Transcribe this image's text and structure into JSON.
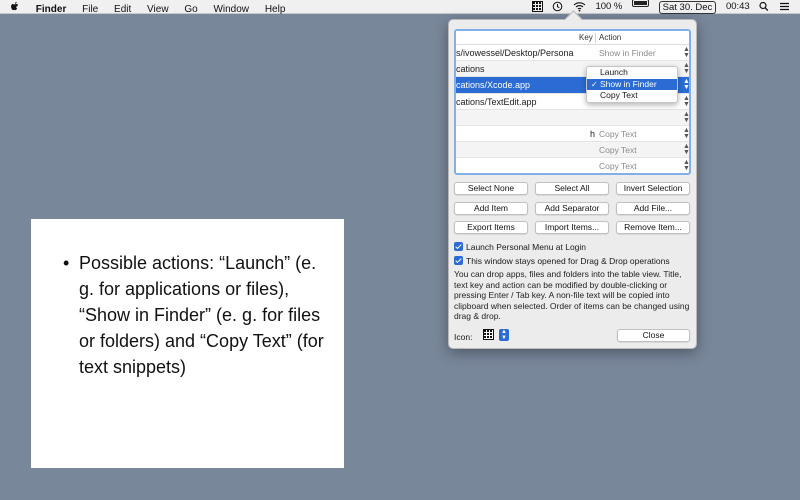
{
  "menubar": {
    "app_name": "Finder",
    "menus": [
      "File",
      "Edit",
      "View",
      "Go",
      "Window",
      "Help"
    ],
    "battery": "100 %",
    "date": "Sat 30. Dec",
    "time": "00:43",
    "icons": [
      "apple-icon",
      "personal-menu-grid-icon",
      "time-machine-icon",
      "wifi-icon",
      "battery-icon",
      "search-icon",
      "control-center-icon"
    ]
  },
  "slide": {
    "bullet": "Possible actions: “Launch” (e. g. for applications or files), “Show in Finder” (e. g. for files or folders) and “Copy Text” (for text snippets)"
  },
  "table": {
    "headers": {
      "key": "Key",
      "action": "Action"
    },
    "rows": [
      {
        "path": "s/ivowessel/Desktop/Persona...",
        "key": "",
        "action": "Show in Finder"
      },
      {
        "path": "cations",
        "key": "",
        "action": ""
      },
      {
        "path": "cations/Xcode.app",
        "key": "",
        "action": ""
      },
      {
        "path": "cations/TextEdit.app",
        "key": "",
        "action": ""
      },
      {
        "path": "",
        "key": "",
        "action": ""
      },
      {
        "path": "",
        "key": "h",
        "action": "Copy Text"
      },
      {
        "path": "",
        "key": "",
        "action": "Copy Text"
      },
      {
        "path": "",
        "key": "",
        "action": "Copy Text"
      }
    ]
  },
  "dropdown": {
    "options": [
      "Launch",
      "Show in Finder",
      "Copy Text"
    ],
    "selected": "Show in Finder"
  },
  "buttons": {
    "select_none": "Select None",
    "select_all": "Select All",
    "invert_selection": "Invert Selection",
    "add_item": "Add Item",
    "add_separator": "Add Separator",
    "add_file": "Add File...",
    "export_items": "Export Items",
    "import_items": "Import Items...",
    "remove_item": "Remove Item...",
    "close": "Close"
  },
  "options": {
    "launch_at_login": "Launch Personal Menu at Login",
    "stays_open": "This window stays opened for Drag & Drop operations"
  },
  "description": "You can drop apps, files and folders into the table view. Title, text key and action can be modified by double-clicking or pressing Enter / Tab key. A non-file text will be copied into clipboard when selected. Order of items can be changed using drag & drop.",
  "icon_label": "Icon:",
  "colors": {
    "desktop": "#79879b",
    "selection": "#2a6cd4",
    "focus_ring": "#7fb0e8"
  }
}
